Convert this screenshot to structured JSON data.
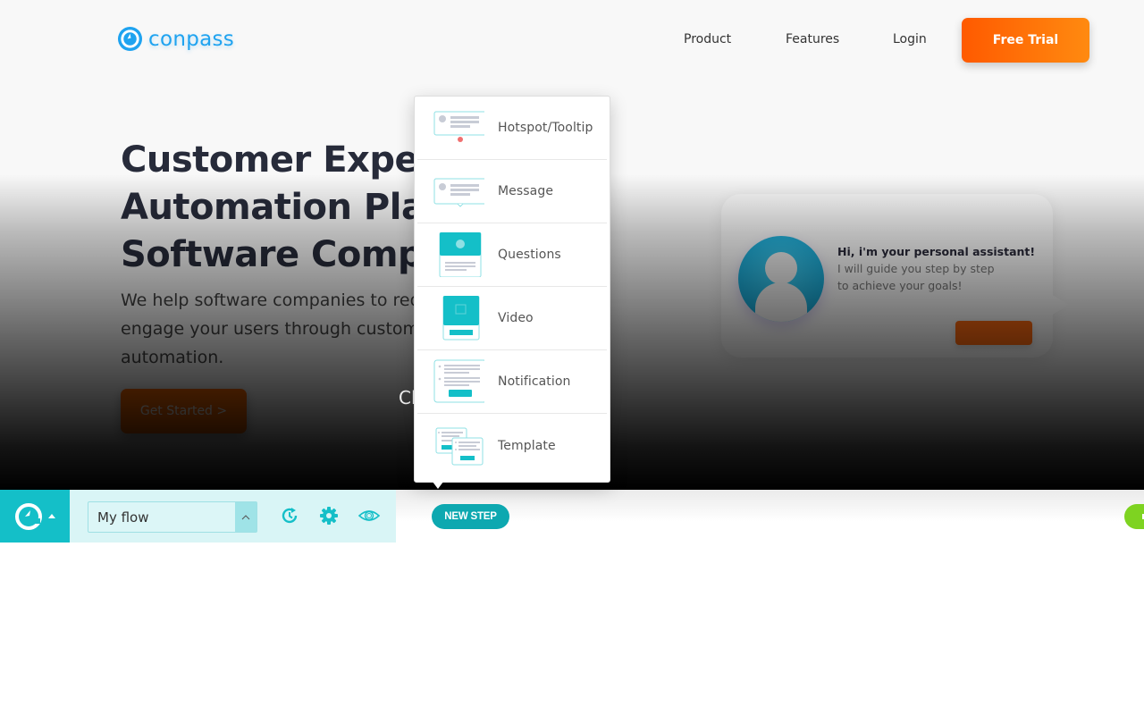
{
  "site": {
    "logo_text": "conpass",
    "nav": {
      "product": "Product",
      "features": "Features",
      "login": "Login",
      "free_trial": "Free Trial"
    },
    "hero": {
      "title_lines": [
        "Customer Exper",
        "Automation Pla",
        "Software Comp"
      ],
      "subtitle_lines": [
        "We help software companies to red",
        "engage your users through custom",
        "automation."
      ],
      "cta": "Get Started >",
      "partial_text": "Cl"
    },
    "assistant_card": {
      "title": "Hi, i'm your personal assistant!",
      "line1": "I will guide you step by step",
      "line2": "to achieve your goals!"
    }
  },
  "step_menu": {
    "items": [
      {
        "label": "Hotspot/Tooltip",
        "icon": "hotspot-tooltip-icon"
      },
      {
        "label": "Message",
        "icon": "message-icon"
      },
      {
        "label": "Questions",
        "icon": "questions-icon"
      },
      {
        "label": "Video",
        "icon": "video-icon"
      },
      {
        "label": "Notification",
        "icon": "notification-icon"
      },
      {
        "label": "Template",
        "icon": "template-icon"
      }
    ]
  },
  "toolbar": {
    "flow_select_value": "My flow",
    "new_step_label": "NEW STEP",
    "icons": [
      "history-icon",
      "gear-icon",
      "eye-icon"
    ]
  },
  "colors": {
    "brand_teal": "#14bfc8",
    "brand_blue": "#1fa3f0",
    "accent_orange": "#ff6a00",
    "new_step_teal": "#0da8b0",
    "status_green": "#7ed321",
    "hotspot_red": "#f07070"
  }
}
